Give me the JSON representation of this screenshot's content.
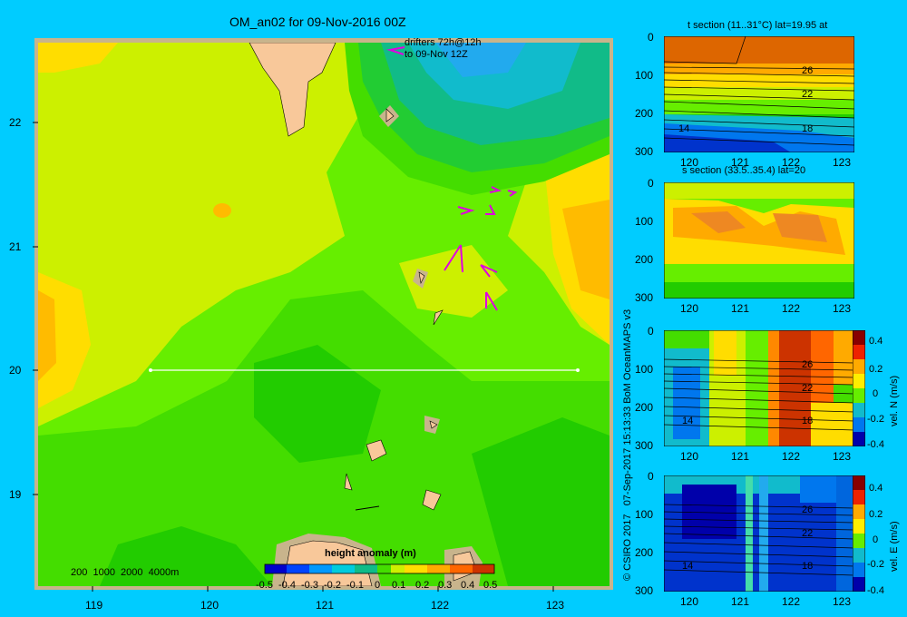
{
  "main_map": {
    "title": "OM_an02 for 09-Nov-2016 00Z",
    "drifters_line1": "drifters 72h@12h",
    "drifters_line2": "to 09-Nov 12Z",
    "depth_legend": "200  1000  2000  4000m",
    "colorbar_title": "height anomaly (m)",
    "colorbar_ticks": [
      "-0.5",
      "-0.4",
      "-0.3",
      "-0.2",
      "-0.1",
      "0",
      "0.1",
      "0.2",
      "0.3",
      "0.4",
      "0.5"
    ],
    "x_ticks": [
      "119",
      "120",
      "121",
      "122",
      "123"
    ],
    "y_ticks": [
      "22",
      "21",
      "20",
      "19"
    ]
  },
  "credit": "© CSIRO 2017   07-Sep-2017 15:13:33 BoM OceanMAPS v3",
  "panels": [
    {
      "title": "t section (11..31°C) lat=19.95 at",
      "y_ticks": [
        "0",
        "100",
        "200",
        "300"
      ],
      "x_ticks": [
        "120",
        "121",
        "122",
        "123"
      ],
      "contour_labels": [
        "26",
        "22",
        "14",
        "18"
      ]
    },
    {
      "title": "s section (33.5..35.4) lat=20",
      "y_ticks": [
        "0",
        "100",
        "200",
        "300"
      ],
      "x_ticks": [
        "120",
        "121",
        "122",
        "123"
      ],
      "contour_labels": []
    },
    {
      "title": "",
      "y_ticks": [
        "0",
        "100",
        "200",
        "300"
      ],
      "x_ticks": [
        "120",
        "121",
        "122",
        "123"
      ],
      "contour_labels": [
        "26",
        "22",
        "14",
        "18"
      ],
      "cbar_label": "vel. N (m/s)",
      "cbar_ticks": [
        "0.4",
        "0.2",
        "0",
        "-0.2",
        "-0.4"
      ]
    },
    {
      "title": "",
      "y_ticks": [
        "0",
        "100",
        "200",
        "300"
      ],
      "x_ticks": [
        "120",
        "121",
        "122",
        "123"
      ],
      "contour_labels": [
        "26",
        "22",
        "14",
        "18"
      ],
      "cbar_label": "vel. E (m/s)",
      "cbar_ticks": [
        "0.4",
        "0.2",
        "0",
        "-0.2",
        "-0.4"
      ]
    }
  ],
  "colors": {
    "background": "#00ccff",
    "land": "#f8c89a",
    "shelf": "#c8b48c",
    "drifter": "#e000e0"
  }
}
